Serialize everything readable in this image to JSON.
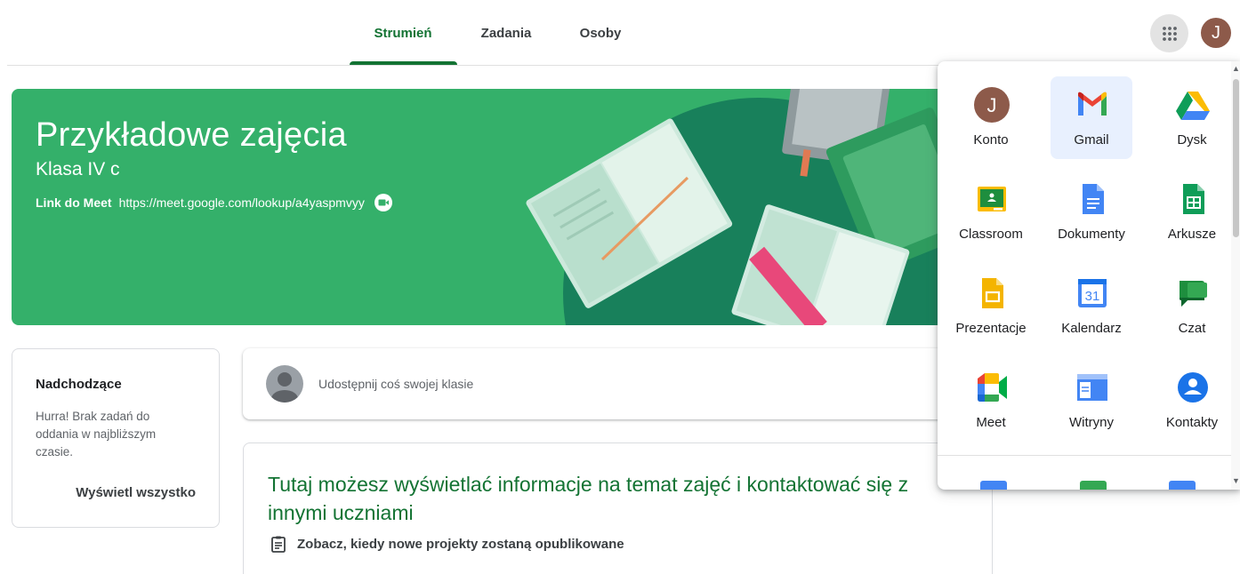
{
  "nav": {
    "tabs": [
      {
        "label": "Strumień",
        "active": true
      },
      {
        "label": "Zadania",
        "active": false
      },
      {
        "label": "Osoby",
        "active": false
      }
    ],
    "account_initial": "J"
  },
  "banner": {
    "title": "Przykładowe zajęcia",
    "section": "Klasa IV c",
    "meet_label": "Link do Meet",
    "meet_url": "https://meet.google.com/lookup/a4yaspmvyy",
    "color": "#34b06a"
  },
  "upcoming": {
    "title": "Nadchodzące",
    "message": "Hurra! Brak zadań do oddania w najbliższym czasie.",
    "view_all": "Wyświetl wszystko"
  },
  "share": {
    "placeholder": "Udostępnij coś swojej klasie"
  },
  "info": {
    "headline": "Tutaj możesz wyświetlać informacje na temat zajęć i kontaktować się z innymi uczniami",
    "subtitle": "Zobacz, kiedy nowe projekty zostaną opublikowane"
  },
  "apps_menu": {
    "items": [
      {
        "label": "Konto",
        "icon": "account-avatar-icon",
        "highlighted": false
      },
      {
        "label": "Gmail",
        "icon": "gmail-icon",
        "highlighted": true
      },
      {
        "label": "Dysk",
        "icon": "drive-icon",
        "highlighted": false
      },
      {
        "label": "Classroom",
        "icon": "classroom-icon",
        "highlighted": false
      },
      {
        "label": "Dokumenty",
        "icon": "docs-icon",
        "highlighted": false
      },
      {
        "label": "Arkusze",
        "icon": "sheets-icon",
        "highlighted": false
      },
      {
        "label": "Prezentacje",
        "icon": "slides-icon",
        "highlighted": false
      },
      {
        "label": "Kalendarz",
        "icon": "calendar-icon",
        "highlighted": false
      },
      {
        "label": "Czat",
        "icon": "chat-icon",
        "highlighted": false
      },
      {
        "label": "Meet",
        "icon": "meet-icon",
        "highlighted": false
      },
      {
        "label": "Witryny",
        "icon": "sites-icon",
        "highlighted": false
      },
      {
        "label": "Kontakty",
        "icon": "contacts-icon",
        "highlighted": false
      }
    ],
    "account_initial": "J",
    "calendar_day": "31"
  },
  "colors": {
    "accent_green": "#137333",
    "banner_green": "#34b06a",
    "text_primary": "#202124",
    "text_secondary": "#5f6368"
  }
}
